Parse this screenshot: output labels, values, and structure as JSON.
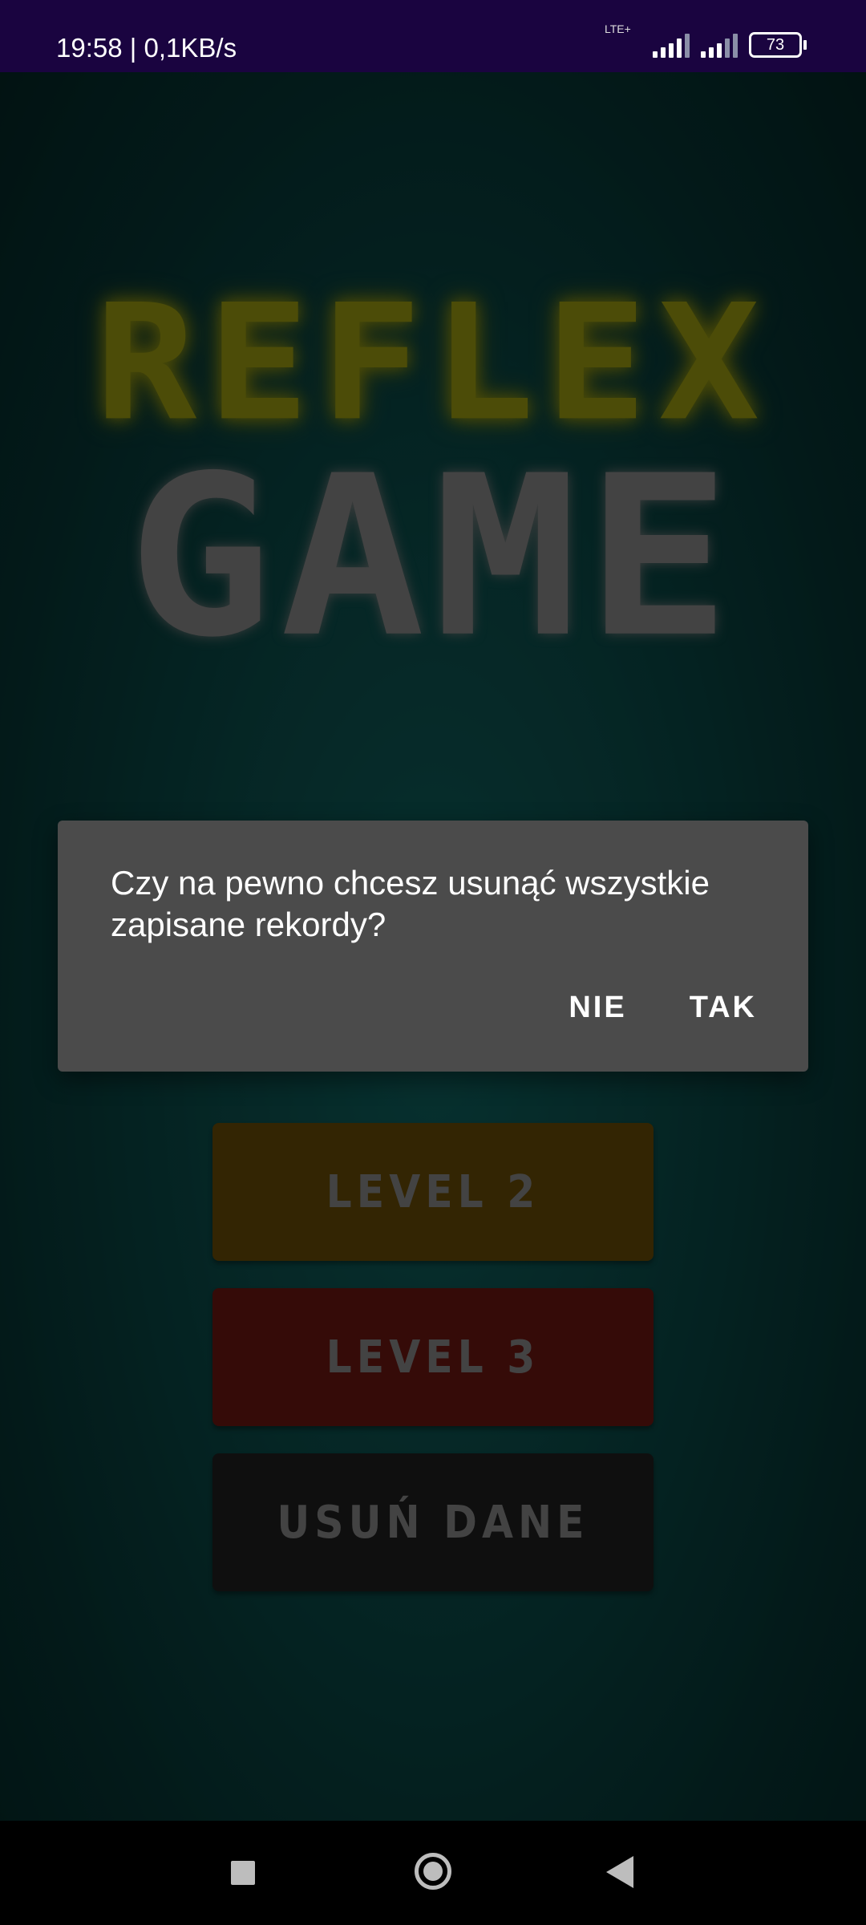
{
  "status_bar": {
    "time": "19:58",
    "speed": "0,1KB/s",
    "network_label": "LTE+",
    "battery": "73"
  },
  "logo": {
    "line1": "REFLEX",
    "line2": "GAME"
  },
  "menu": {
    "level2": "LEVEL 2",
    "level3": "LEVEL 3",
    "delete": "USUŃ DANE"
  },
  "dialog": {
    "message": "Czy na pewno chcesz usunąć wszystkie zapisane rekordy?",
    "negative": "NIE",
    "positive": "TAK"
  },
  "colors": {
    "status_bar": "#1a0440",
    "level1": "#235512",
    "level2": "#5d4407",
    "level3": "#621510",
    "delete": "#1c1c1c",
    "dialog": "#4b4b4b"
  },
  "icons": {
    "nav_recent": "square-icon",
    "nav_home": "circle-icon",
    "nav_back": "triangle-back-icon"
  }
}
